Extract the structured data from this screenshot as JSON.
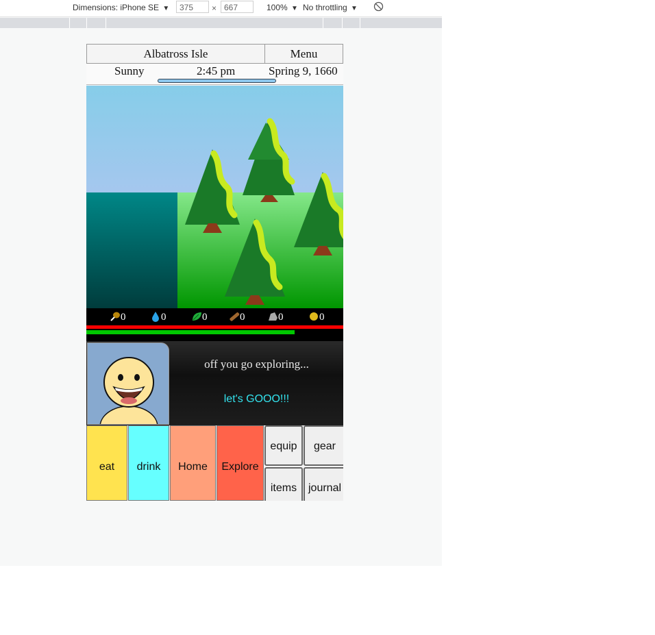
{
  "devtools": {
    "dimensions_label": "Dimensions: iPhone SE",
    "width_value": "375",
    "times": "×",
    "height_value": "667",
    "zoom": "100%",
    "throttling": "No throttling",
    "dropdown_arrow": "▼"
  },
  "game": {
    "location": "Albatross Isle",
    "menu_label": "Menu",
    "weather": "Sunny",
    "time": "2:45 pm",
    "date": "Spring 9, 1660",
    "day_progress": 1.0,
    "resources": [
      {
        "name": "meat-icon",
        "value": "0"
      },
      {
        "name": "water-icon",
        "value": "0"
      },
      {
        "name": "leaf-icon",
        "value": "0"
      },
      {
        "name": "wood-icon",
        "value": "0"
      },
      {
        "name": "stone-icon",
        "value": "0"
      },
      {
        "name": "coin-icon",
        "value": "0"
      }
    ],
    "health_fraction": 1.0,
    "energy_fraction": 0.81,
    "message": "off you go exploring...",
    "reply": "let's GOOO!!!",
    "actions": {
      "eat": "eat",
      "drink": "drink",
      "home": "Home",
      "explore": "Explore",
      "equip": "equip",
      "gear": "gear",
      "items": "items",
      "journal": "journal"
    }
  },
  "colors": {
    "eat": "#ffe34f",
    "drink": "#66ffff",
    "home": "#ff9f7a",
    "explore": "#ff634a",
    "sky_top": "#8ccfe9",
    "water": "#008080",
    "grass": "#2fcc2f"
  }
}
